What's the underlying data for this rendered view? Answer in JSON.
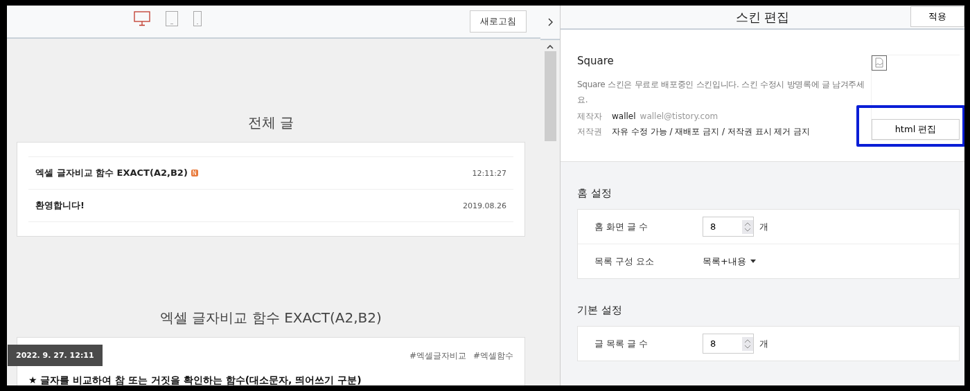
{
  "toolbar": {
    "devices": [
      {
        "kind": "desktop",
        "selected": true
      },
      {
        "kind": "tablet",
        "selected": false
      },
      {
        "kind": "mobile",
        "selected": false
      }
    ],
    "refresh_button": "새로고침"
  },
  "preview": {
    "list_heading": "전체 글",
    "posts": [
      {
        "title": "엑셀 글자비교 함수 EXACT(A2,B2)",
        "badge": "N",
        "date": "12:11:27"
      },
      {
        "title": "환영합니다!",
        "date": "2019.08.26"
      }
    ],
    "article": {
      "title": "엑셀 글자비교 함수 EXACT(A2,B2)",
      "date_badge": "2022. 9. 27. 12:11",
      "tags": [
        "#엑셀글자비교",
        "#엑셀함수"
      ],
      "first_line": "★ 글자를 비교하여 참 또는 거짓을 확인하는 함수(대소문자, 띄어쓰기 구분)"
    }
  },
  "panel": {
    "title": "스킨 편집",
    "apply_button": "적용",
    "skin": {
      "name": "Square",
      "description": "Square 스킨은 무료로 배포중인 스킨입니다. 스킨 수정시 방명록에 글 남겨주세요.",
      "meta": [
        {
          "label": "제작자",
          "value": "wallel",
          "extra": "wallel@tistory.com"
        },
        {
          "label": "저작권",
          "value": "자유 수정 가능 / 재배포 금지 / 저작권 표시 제거 금지"
        }
      ],
      "edit_button": "html 편집",
      "highlighted": true
    },
    "sections": [
      {
        "title": "홈 설정",
        "rows": [
          {
            "kind": "number",
            "label": "홈 화면 글 수",
            "value": "8",
            "unit": "개"
          },
          {
            "kind": "select",
            "label": "목록 구성 요소",
            "value": "목록+내용"
          }
        ]
      },
      {
        "title": "기본 설정",
        "rows": [
          {
            "kind": "number",
            "label": "글 목록 글 수",
            "value": "8",
            "unit": "개"
          }
        ]
      }
    ]
  }
}
